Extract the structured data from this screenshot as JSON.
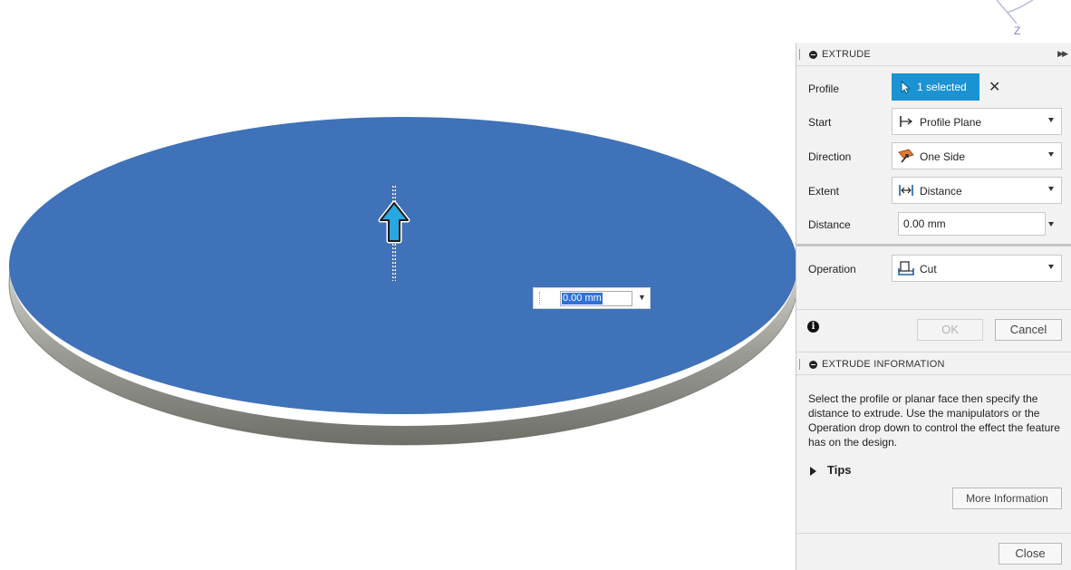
{
  "viewport": {
    "distance_value": "0.00 mm",
    "viewcube_axis_label": "Z"
  },
  "extrude": {
    "title": "EXTRUDE",
    "profile": {
      "label": "Profile",
      "selection": "1 selected"
    },
    "start": {
      "label": "Start",
      "value": "Profile Plane",
      "icon": "profile-plane-icon"
    },
    "direction": {
      "label": "Direction",
      "value": "One Side",
      "icon": "one-side-icon"
    },
    "extent": {
      "label": "Extent",
      "value": "Distance",
      "icon": "distance-extent-icon"
    },
    "distance": {
      "label": "Distance",
      "value": "0.00 mm"
    },
    "operation": {
      "label": "Operation",
      "value": "Cut",
      "icon": "cut-icon"
    },
    "ok_label": "OK",
    "cancel_label": "Cancel"
  },
  "info": {
    "title": "EXTRUDE INFORMATION",
    "description": "Select the profile or planar face then specify the distance to extrude. Use the manipulators or the Operation drop down to control the effect the feature has on the design.",
    "tips_label": "Tips",
    "more_info_label": "More Information",
    "close_label": "Close"
  },
  "colors": {
    "disc_face": "#3f72b8",
    "selection_button": "#1b93d3",
    "manipulator_arrow": "#29a7e1"
  }
}
